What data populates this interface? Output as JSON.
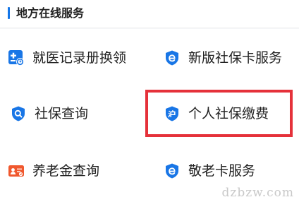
{
  "section": {
    "title": "地方在线服务"
  },
  "services": [
    {
      "label": "就医记录册换领",
      "icon": "medical-record-icon",
      "color": "#1976e6"
    },
    {
      "label": "新版社保卡服务",
      "icon": "e-shield-icon",
      "color": "#1976e6"
    },
    {
      "label": "社保查询",
      "icon": "search-shield-icon",
      "color": "#1976e6"
    },
    {
      "label": "个人社保缴费",
      "icon": "hu-shield-icon",
      "color": "#1976e6"
    },
    {
      "label": "养老金查询",
      "icon": "pension-card-icon",
      "color": "#f0582e"
    },
    {
      "label": "敬老卡服务",
      "icon": "e-shield-icon",
      "color": "#1976e6"
    }
  ],
  "highlight": {
    "color": "#e5313a",
    "target": "个人社保缴费"
  },
  "watermark": "dzbzw.com"
}
